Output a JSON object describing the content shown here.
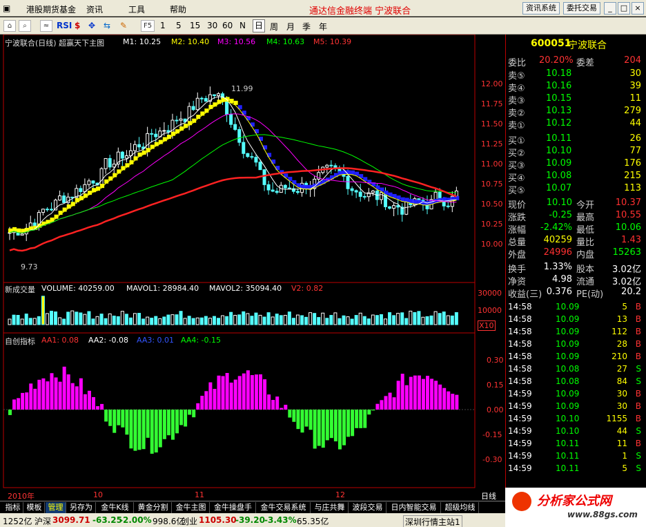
{
  "menu": [
    "港股期货基金",
    "资讯",
    "工具",
    "帮助"
  ],
  "app_title": "通达信金融终端 宁波联合",
  "top_buttons": [
    "资讯系统",
    "委托交易"
  ],
  "window_buttons": [
    "_",
    "□",
    "×"
  ],
  "toolbar": {
    "icons": [
      "chart-icon",
      "zoom-icon",
      "indicator-icon",
      "rsi-icon",
      "dollar-icon",
      "move-icon",
      "export-icon",
      "pen-icon",
      "f5-icon"
    ],
    "rsi": "RSI",
    "f5": "F5",
    "periods": [
      "1",
      "5",
      "15",
      "30",
      "60",
      "N",
      "日",
      "周",
      "月",
      "季",
      "年"
    ],
    "active_period": "日"
  },
  "main": {
    "title": "宁波联合(日线) 超赢天下主图",
    "ma": [
      {
        "label": "M1: 10.25",
        "color": "#ffffff"
      },
      {
        "label": "M2: 10.40",
        "color": "#ffff00"
      },
      {
        "label": "M3: 10.56",
        "color": "#ff00ff"
      },
      {
        "label": "M4: 10.63",
        "color": "#00ff00"
      },
      {
        "label": "M5: 10.39",
        "color": "#ff3030"
      }
    ],
    "high_label": "11.99",
    "low_label": "9.73",
    "ticks": [
      "12.00",
      "11.75",
      "11.50",
      "11.25",
      "11.00",
      "10.75",
      "10.50",
      "10.25",
      "10.00"
    ]
  },
  "vol": {
    "title": "新成交量",
    "items": [
      {
        "label": "VOLUME: 40259.00",
        "color": "#ffffff"
      },
      {
        "label": "MAVOL1: 28984.40",
        "color": "#ffffff"
      },
      {
        "label": "MAVOL2: 35094.40",
        "color": "#ffffff"
      },
      {
        "label": "V2: 0.82",
        "color": "#ff3030"
      }
    ],
    "ticks": [
      "30000",
      "10000"
    ],
    "unit": "X10"
  },
  "osc": {
    "title": "自创指标",
    "items": [
      {
        "label": "AA1: 0.08",
        "color": "#ff3030"
      },
      {
        "label": "AA2: -0.08",
        "color": "#ffffff"
      },
      {
        "label": "AA3: 0.01",
        "color": "#3050ff"
      },
      {
        "label": "AA4: -0.15",
        "color": "#00ff00"
      }
    ],
    "ticks": [
      "0.30",
      "0.15",
      "0.00",
      "-0.15",
      "-0.30"
    ]
  },
  "x_axis": {
    "labels": [
      "2010年",
      "10",
      "11",
      "12"
    ],
    "period": "日线"
  },
  "quote": {
    "code": "600051",
    "name": "宁波联合",
    "wb_label": "委比",
    "wb": "20.20%",
    "wc_label": "委差",
    "wc": "204",
    "sells": [
      {
        "l": "卖⑤",
        "p": "10.18",
        "v": "30"
      },
      {
        "l": "卖④",
        "p": "10.16",
        "v": "39"
      },
      {
        "l": "卖③",
        "p": "10.15",
        "v": "11"
      },
      {
        "l": "卖②",
        "p": "10.13",
        "v": "279"
      },
      {
        "l": "卖①",
        "p": "10.12",
        "v": "44"
      }
    ],
    "buys": [
      {
        "l": "买①",
        "p": "10.11",
        "v": "26"
      },
      {
        "l": "买②",
        "p": "10.10",
        "v": "77"
      },
      {
        "l": "买③",
        "p": "10.09",
        "v": "176"
      },
      {
        "l": "买④",
        "p": "10.08",
        "v": "215"
      },
      {
        "l": "买⑤",
        "p": "10.07",
        "v": "113"
      }
    ],
    "stats": [
      {
        "a": "现价",
        "b": "10.10",
        "c": "今开",
        "d": "10.37",
        "bc": "#00ff00",
        "dc": "#ff3030"
      },
      {
        "a": "涨跌",
        "b": "-0.25",
        "c": "最高",
        "d": "10.55",
        "bc": "#00ff00",
        "dc": "#ff3030"
      },
      {
        "a": "涨幅",
        "b": "-2.42%",
        "c": "最低",
        "d": "10.06",
        "bc": "#00ff00",
        "dc": "#00ff00"
      },
      {
        "a": "总量",
        "b": "40259",
        "c": "量比",
        "d": "1.43",
        "bc": "#ffff00",
        "dc": "#ff3030"
      },
      {
        "a": "外盘",
        "b": "24996",
        "c": "内盘",
        "d": "15263",
        "bc": "#ff3030",
        "dc": "#00ff00"
      }
    ],
    "stats2": [
      {
        "a": "换手",
        "b": "1.33%",
        "c": "股本",
        "d": "3.02亿"
      },
      {
        "a": "净资",
        "b": "4.98",
        "c": "流通",
        "d": "3.02亿"
      },
      {
        "a": "收益(三)",
        "b": "0.376",
        "c": "PE(动)",
        "d": "20.2"
      }
    ],
    "ticks": [
      {
        "t": "14:58",
        "p": "10.09",
        "v": "5",
        "s": "B"
      },
      {
        "t": "14:58",
        "p": "10.09",
        "v": "13",
        "s": "B"
      },
      {
        "t": "14:58",
        "p": "10.09",
        "v": "112",
        "s": "B"
      },
      {
        "t": "14:58",
        "p": "10.09",
        "v": "28",
        "s": "B"
      },
      {
        "t": "14:58",
        "p": "10.09",
        "v": "210",
        "s": "B"
      },
      {
        "t": "14:58",
        "p": "10.08",
        "v": "27",
        "s": "S"
      },
      {
        "t": "14:58",
        "p": "10.08",
        "v": "84",
        "s": "S"
      },
      {
        "t": "14:59",
        "p": "10.09",
        "v": "30",
        "s": "B"
      },
      {
        "t": "14:59",
        "p": "10.09",
        "v": "30",
        "s": "B"
      },
      {
        "t": "14:59",
        "p": "10.10",
        "v": "1155",
        "s": "B"
      },
      {
        "t": "14:59",
        "p": "10.10",
        "v": "44",
        "s": "S"
      },
      {
        "t": "14:59",
        "p": "10.11",
        "v": "11",
        "s": "B"
      },
      {
        "t": "14:59",
        "p": "10.11",
        "v": "1",
        "s": "S"
      },
      {
        "t": "14:59",
        "p": "10.11",
        "v": "5",
        "s": "S"
      }
    ]
  },
  "tabs": [
    "指标",
    "模板",
    "管理",
    "另存为",
    "金牛K线",
    "黄金分割",
    "金牛主图",
    "金牛操盘手",
    "金牛交易系统",
    "与庄共舞",
    "波段交易",
    "日内智能交易",
    "超级均线"
  ],
  "active_tab": "管理",
  "status": {
    "a": "1252亿",
    "b": "沪深",
    "c": "3099.71",
    "d": "-63.25",
    "e": "-2.00%",
    "f": "998.6亿",
    "g": "创业",
    "h": "1105.30",
    "i": "-39.20",
    "j": "-3.43%",
    "k": "65.35亿",
    "l": "深圳行情主站1"
  },
  "logo": {
    "text": "分析家公式网",
    "url": "www.88gs.com"
  }
}
